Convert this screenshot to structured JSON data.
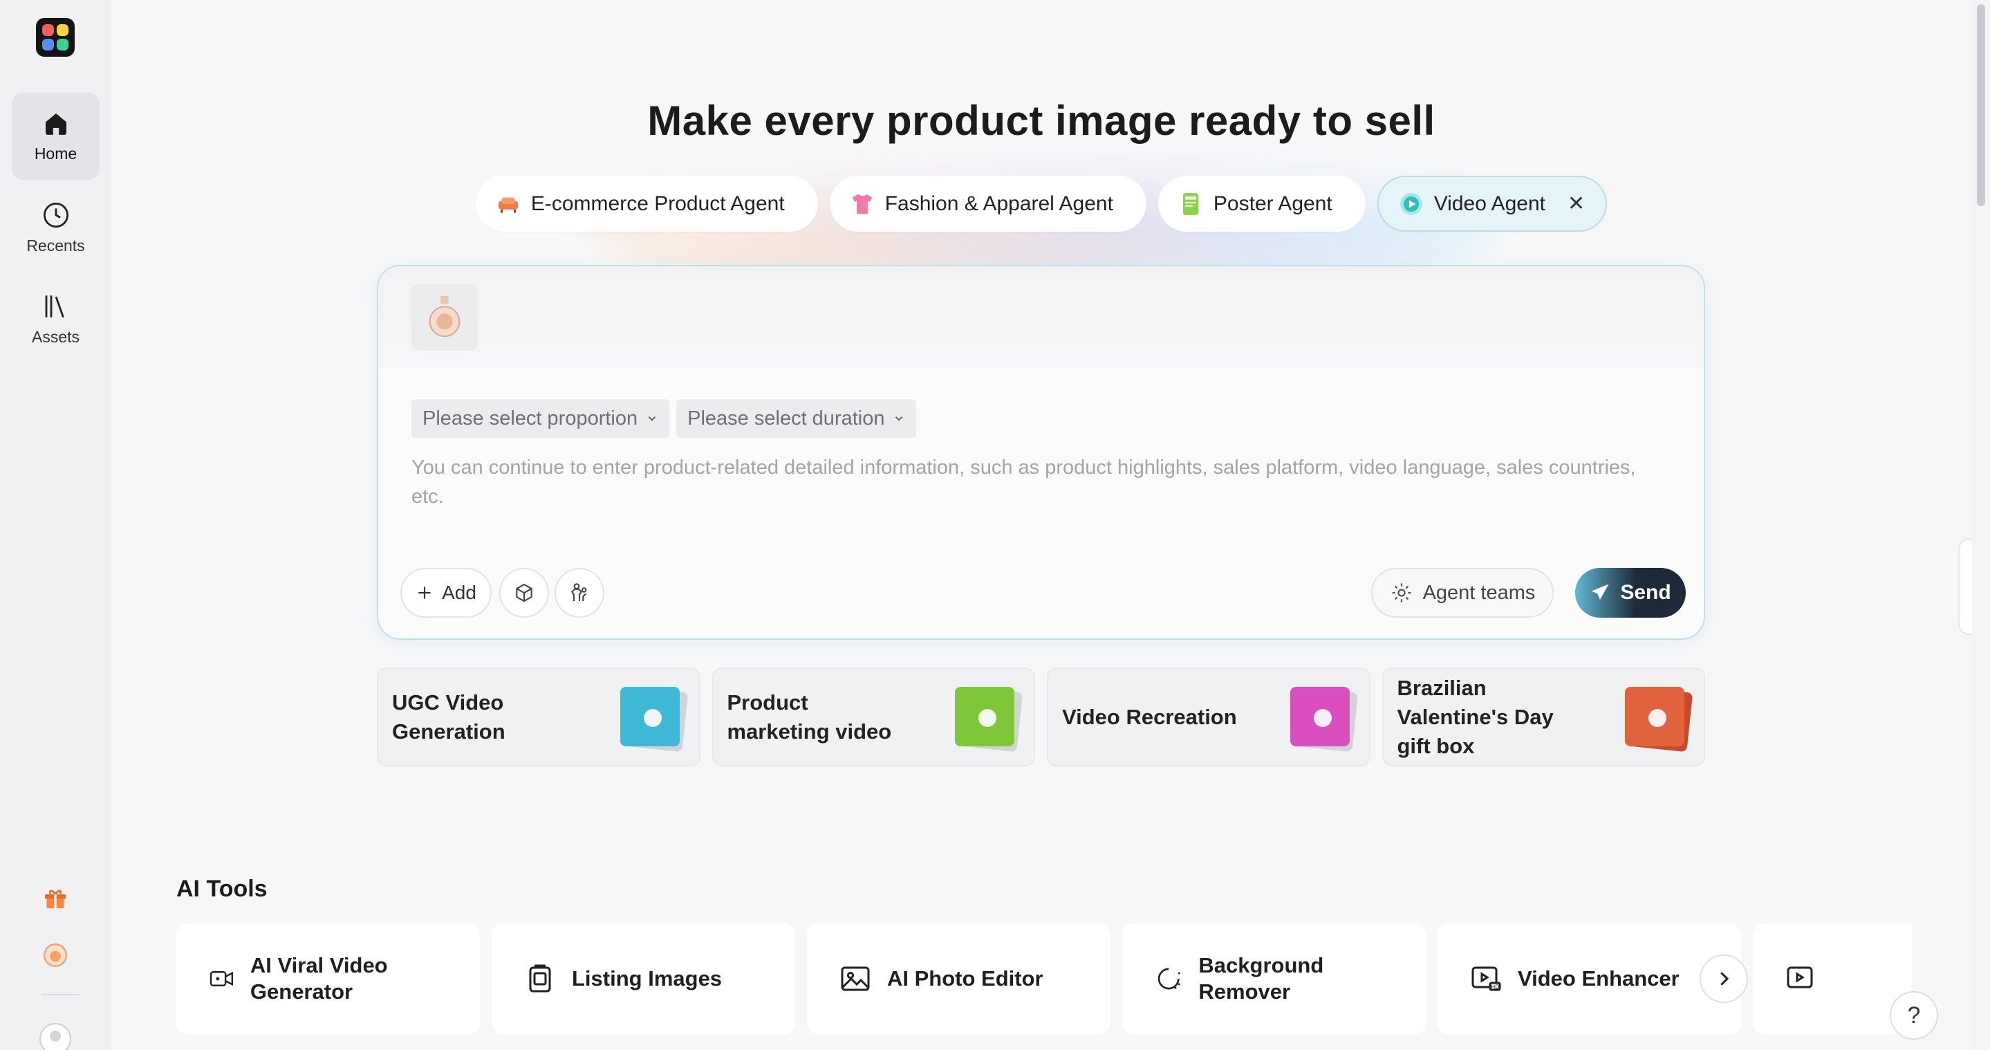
{
  "sidebar": {
    "items": [
      {
        "label": "Home",
        "icon": "home-icon",
        "active": true
      },
      {
        "label": "Recents",
        "icon": "clock-icon",
        "active": false
      },
      {
        "label": "Assets",
        "icon": "library-icon",
        "active": false
      }
    ]
  },
  "hero": {
    "title": "Make every product image ready to sell"
  },
  "agents": [
    {
      "label": "E-commerce Product Agent",
      "icon": "sofa-icon"
    },
    {
      "label": "Fashion & Apparel Agent",
      "icon": "tshirt-icon"
    },
    {
      "label": "Poster Agent",
      "icon": "poster-icon"
    },
    {
      "label": "Video Agent",
      "icon": "video-play-icon",
      "active": true
    }
  ],
  "composer": {
    "proportion_placeholder": "Please select proportion",
    "duration_placeholder": "Please select duration",
    "prompt_placeholder": "You can continue to enter product-related detailed information, such as product highlights, sales platform, video language, sales countries, etc.",
    "add_label": "Add",
    "agent_teams_label": "Agent teams",
    "send_label": "Send"
  },
  "templates": [
    {
      "label": "UGC Video Generation",
      "color": "#3fb7d6"
    },
    {
      "label": "Product marketing video",
      "color": "#7fc63a"
    },
    {
      "label": "Video Recreation",
      "color": "#d94fbf"
    },
    {
      "label": "Brazilian Valentine's Day gift box",
      "color": "#e0633d"
    }
  ],
  "ai_tools": {
    "title": "AI Tools",
    "items": [
      {
        "label": "AI Viral Video Generator",
        "icon": "video-camera-icon"
      },
      {
        "label": "Listing Images",
        "icon": "listing-images-icon"
      },
      {
        "label": "AI Photo Editor",
        "icon": "photo-editor-icon"
      },
      {
        "label": "Background Remover",
        "icon": "background-remover-icon"
      },
      {
        "label": "Video Enhancer",
        "icon": "video-enhancer-icon"
      },
      {
        "label": "",
        "icon": "video-tool-icon"
      }
    ]
  },
  "help": {
    "label": "?"
  },
  "colors": {
    "accent": "#5fb8d4",
    "send_dark": "#1e2a3a",
    "gift": "#f26b1d"
  }
}
